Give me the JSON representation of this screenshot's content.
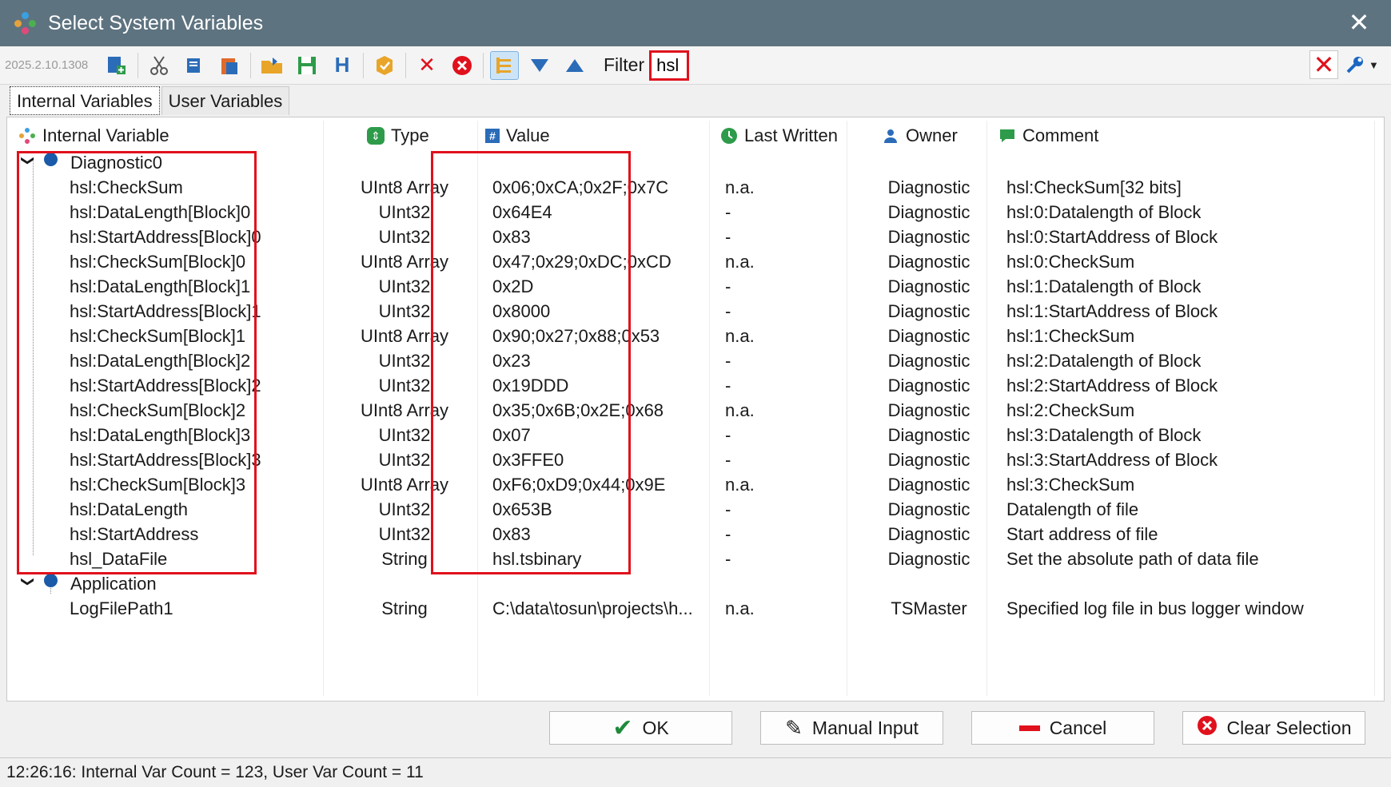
{
  "window": {
    "title": "Select System Variables",
    "close_glyph": "✕"
  },
  "toolbar": {
    "version": "2025.2.10.1308",
    "filter_label": "Filter",
    "filter_value": "hsl",
    "icons": [
      "add-variable-icon",
      "cut-icon",
      "copy-icon",
      "paste-icon",
      "open-folder-icon",
      "save-icon",
      "h-icon",
      "badge-icon",
      "delete-icon",
      "delete-all-icon",
      "tree-view-icon",
      "move-down-icon",
      "move-up-icon"
    ]
  },
  "tabs": [
    {
      "label": "Internal Variables",
      "active": true
    },
    {
      "label": "User Variables",
      "active": false
    }
  ],
  "columns": {
    "name": "Internal Variable",
    "type": "Type",
    "value": "Value",
    "last_written": "Last Written",
    "owner": "Owner",
    "comment": "Comment"
  },
  "groups": [
    {
      "name": "Diagnostic0",
      "rows": [
        {
          "name": "hsl:CheckSum",
          "type": "UInt8 Array",
          "value": "0x06;0xCA;0x2F;0x7C",
          "last": "n.a.",
          "owner": "Diagnostic",
          "comment": "hsl:CheckSum[32 bits]"
        },
        {
          "name": "hsl:DataLength[Block]0",
          "type": "UInt32",
          "value": "0x64E4",
          "last": "-",
          "owner": "Diagnostic",
          "comment": "hsl:0:Datalength of Block"
        },
        {
          "name": "hsl:StartAddress[Block]0",
          "type": "UInt32",
          "value": "0x83",
          "last": "-",
          "owner": "Diagnostic",
          "comment": "hsl:0:StartAddress of Block"
        },
        {
          "name": "hsl:CheckSum[Block]0",
          "type": "UInt8 Array",
          "value": "0x47;0x29;0xDC;0xCD",
          "last": "n.a.",
          "owner": "Diagnostic",
          "comment": "hsl:0:CheckSum"
        },
        {
          "name": "hsl:DataLength[Block]1",
          "type": "UInt32",
          "value": "0x2D",
          "last": "-",
          "owner": "Diagnostic",
          "comment": "hsl:1:Datalength of Block"
        },
        {
          "name": "hsl:StartAddress[Block]1",
          "type": "UInt32",
          "value": "0x8000",
          "last": "-",
          "owner": "Diagnostic",
          "comment": "hsl:1:StartAddress of Block"
        },
        {
          "name": "hsl:CheckSum[Block]1",
          "type": "UInt8 Array",
          "value": "0x90;0x27;0x88;0x53",
          "last": "n.a.",
          "owner": "Diagnostic",
          "comment": "hsl:1:CheckSum"
        },
        {
          "name": "hsl:DataLength[Block]2",
          "type": "UInt32",
          "value": "0x23",
          "last": "-",
          "owner": "Diagnostic",
          "comment": "hsl:2:Datalength of Block"
        },
        {
          "name": "hsl:StartAddress[Block]2",
          "type": "UInt32",
          "value": "0x19DDD",
          "last": "-",
          "owner": "Diagnostic",
          "comment": "hsl:2:StartAddress of Block"
        },
        {
          "name": "hsl:CheckSum[Block]2",
          "type": "UInt8 Array",
          "value": "0x35;0x6B;0x2E;0x68",
          "last": "n.a.",
          "owner": "Diagnostic",
          "comment": "hsl:2:CheckSum"
        },
        {
          "name": "hsl:DataLength[Block]3",
          "type": "UInt32",
          "value": "0x07",
          "last": "-",
          "owner": "Diagnostic",
          "comment": "hsl:3:Datalength of Block"
        },
        {
          "name": "hsl:StartAddress[Block]3",
          "type": "UInt32",
          "value": "0x3FFE0",
          "last": "-",
          "owner": "Diagnostic",
          "comment": "hsl:3:StartAddress of Block"
        },
        {
          "name": "hsl:CheckSum[Block]3",
          "type": "UInt8 Array",
          "value": "0xF6;0xD9;0x44;0x9E",
          "last": "n.a.",
          "owner": "Diagnostic",
          "comment": "hsl:3:CheckSum"
        },
        {
          "name": "hsl:DataLength",
          "type": "UInt32",
          "value": "0x653B",
          "last": "-",
          "owner": "Diagnostic",
          "comment": "Datalength of file"
        },
        {
          "name": "hsl:StartAddress",
          "type": "UInt32",
          "value": "0x83",
          "last": "-",
          "owner": "Diagnostic",
          "comment": "Start address of file"
        },
        {
          "name": "hsl_DataFile",
          "type": "String",
          "value": "hsl.tsbinary",
          "last": "-",
          "owner": "Diagnostic",
          "comment": "Set the absolute path of data file"
        }
      ]
    },
    {
      "name": "Application",
      "rows": [
        {
          "name": "LogFilePath1",
          "type": "String",
          "value": "C:\\data\\tosun\\projects\\h...",
          "last": "n.a.",
          "owner": "TSMaster",
          "comment": "Specified log file in bus logger window"
        }
      ]
    }
  ],
  "buttons": {
    "ok": "OK",
    "manual_input": "Manual Input",
    "cancel": "Cancel",
    "clear_selection": "Clear Selection"
  },
  "status": "12:26:16: Internal Var Count = 123, User Var Count = 11",
  "colors": {
    "titlebar": "#5e7380",
    "highlight": "#e0111c",
    "node_dot": "#1b5aa8",
    "ok_check": "#1f8a3a"
  }
}
